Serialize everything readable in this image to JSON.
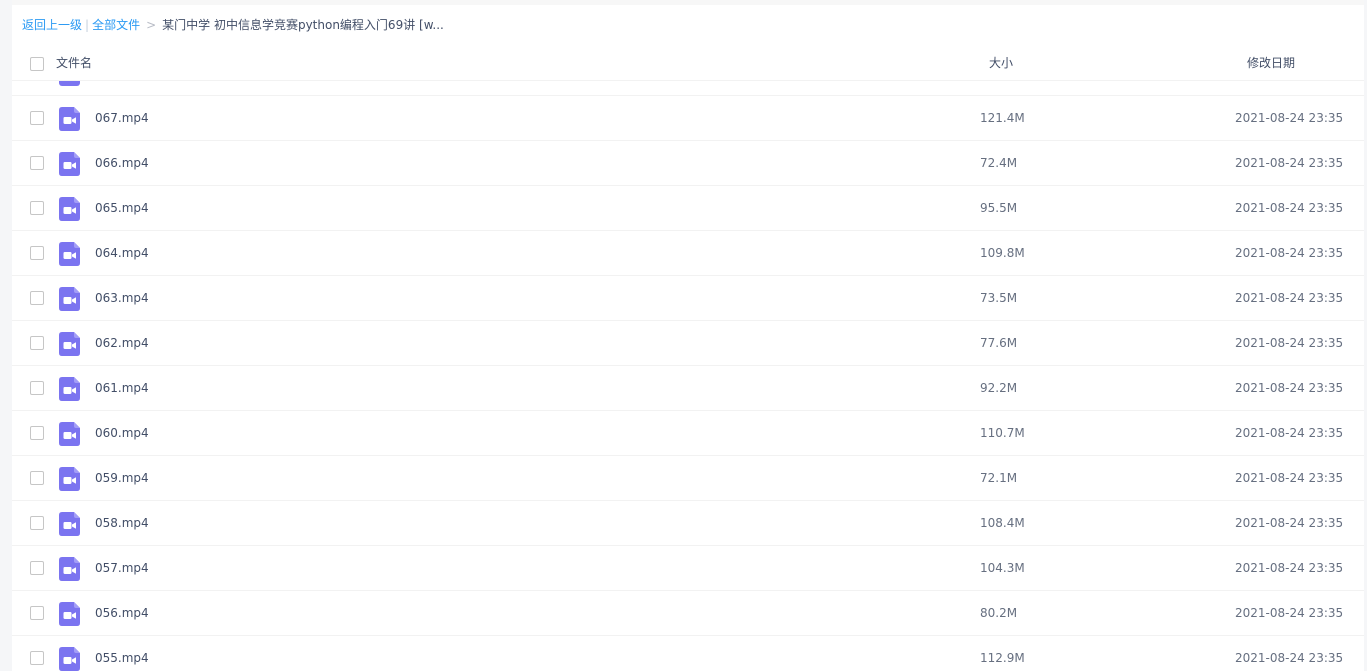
{
  "breadcrumb": {
    "back_label": "返回上一级",
    "separator": "|",
    "all_files_label": "全部文件",
    "arrow": ">",
    "current_folder": "某门中学 初中信息学竞赛python编程入门69讲 [w..."
  },
  "table": {
    "columns": {
      "name": "文件名",
      "size": "大小",
      "date": "修改日期"
    },
    "rows": [
      {
        "name": "067.mp4",
        "size": "121.4M",
        "date": "2021-08-24 23:35"
      },
      {
        "name": "066.mp4",
        "size": "72.4M",
        "date": "2021-08-24 23:35"
      },
      {
        "name": "065.mp4",
        "size": "95.5M",
        "date": "2021-08-24 23:35"
      },
      {
        "name": "064.mp4",
        "size": "109.8M",
        "date": "2021-08-24 23:35"
      },
      {
        "name": "063.mp4",
        "size": "73.5M",
        "date": "2021-08-24 23:35"
      },
      {
        "name": "062.mp4",
        "size": "77.6M",
        "date": "2021-08-24 23:35"
      },
      {
        "name": "061.mp4",
        "size": "92.2M",
        "date": "2021-08-24 23:35"
      },
      {
        "name": "060.mp4",
        "size": "110.7M",
        "date": "2021-08-24 23:35"
      },
      {
        "name": "059.mp4",
        "size": "72.1M",
        "date": "2021-08-24 23:35"
      },
      {
        "name": "058.mp4",
        "size": "108.4M",
        "date": "2021-08-24 23:35"
      },
      {
        "name": "057.mp4",
        "size": "104.3M",
        "date": "2021-08-24 23:35"
      },
      {
        "name": "056.mp4",
        "size": "80.2M",
        "date": "2021-08-24 23:35"
      },
      {
        "name": "055.mp4",
        "size": "112.9M",
        "date": "2021-08-24 23:35"
      }
    ]
  },
  "icons": {
    "file_type_icon": "video-file-icon",
    "checkbox_icon": "checkbox-icon"
  },
  "colors": {
    "link": "#2b9af3",
    "video_icon": "#7b74f0",
    "text": "#424e67",
    "muted_text": "#666f80",
    "divider": "#f2f2f2"
  }
}
